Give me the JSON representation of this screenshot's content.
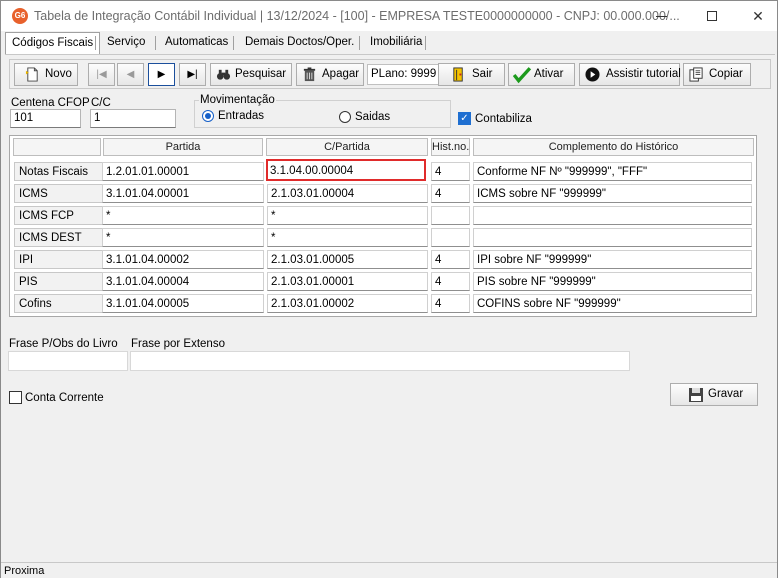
{
  "window": {
    "app_icon_text": "G6",
    "title": "Tabela de Integração Contábil Individual   |  13/12/2024 - [100] - EMPRESA TESTE0000000000 - CNPJ: 00.000.000/...",
    "minimize": "minimize",
    "maximize": "maximize",
    "close": "✕"
  },
  "tabs": [
    {
      "label": "Códigos Fiscais",
      "active": true
    },
    {
      "label": "Serviço"
    },
    {
      "label": "Automaticas"
    },
    {
      "label": "Demais Doctos/Oper."
    },
    {
      "label": "Imobiliária"
    }
  ],
  "toolbar": {
    "novo": "Novo",
    "first": "|◀",
    "prev": "◀",
    "next": "▶",
    "last": "▶|",
    "pesquisar": "Pesquisar",
    "apagar": "Apagar",
    "plano": "PLano: 9999",
    "sair": "Sair",
    "ativar": "Ativar",
    "assistir": "Assistir tutorial",
    "copiar": "Copiar"
  },
  "form": {
    "centena_label": "Centena CFOP",
    "centena_value": "101",
    "cc_label": "C/C",
    "cc_value": "1",
    "movimentacao_label": "Movimentação",
    "entradas_label": "Entradas",
    "saidas_label": "Saidas",
    "contabiliza_label": "Contabiliza",
    "movimentacao_selected": "Entradas",
    "contabiliza_checked": true
  },
  "grid": {
    "headers": [
      "Partida",
      "C/Partida",
      "Hist.no.",
      "Complemento do Histórico"
    ],
    "rows": [
      {
        "label": "Notas Fiscais",
        "partida": "1.2.01.01.00001",
        "cpartida": "3.1.04.00.00004",
        "hist": "4",
        "compl": "Conforme NF Nº \"999999\", \"FFF\""
      },
      {
        "label": "ICMS",
        "partida": "3.1.01.04.00001",
        "cpartida": "2.1.03.01.00004",
        "hist": "4",
        "compl": "ICMS sobre NF \"999999\""
      },
      {
        "label": "ICMS FCP",
        "partida": "*",
        "cpartida": "*",
        "hist": "",
        "compl": ""
      },
      {
        "label": "ICMS DEST",
        "partida": "*",
        "cpartida": "*",
        "hist": "",
        "compl": ""
      },
      {
        "label": "IPI",
        "partida": "3.1.01.04.00002",
        "cpartida": "2.1.03.01.00005",
        "hist": "4",
        "compl": "IPI sobre NF \"999999\""
      },
      {
        "label": "PIS",
        "partida": "3.1.01.04.00004",
        "cpartida": "2.1.03.01.00001",
        "hist": "4",
        "compl": "PIS sobre NF \"999999\""
      },
      {
        "label": "Cofins",
        "partida": "3.1.01.04.00005",
        "cpartida": "2.1.03.01.00002",
        "hist": "4",
        "compl": "COFINS sobre NF \"999999\""
      }
    ]
  },
  "bottom": {
    "frase_livro_label": "Frase P/Obs do Livro",
    "frase_livro_value": "",
    "frase_extenso_label": "Frase por Extenso",
    "frase_extenso_value": "",
    "conta_corrente_label": "Conta Corrente",
    "gravar": "Gravar"
  },
  "status": {
    "text": "Proxima"
  },
  "colors": {
    "accent": "#1660c8",
    "selection_border": "#e02b2b",
    "icon_orange": "#e8612c"
  }
}
